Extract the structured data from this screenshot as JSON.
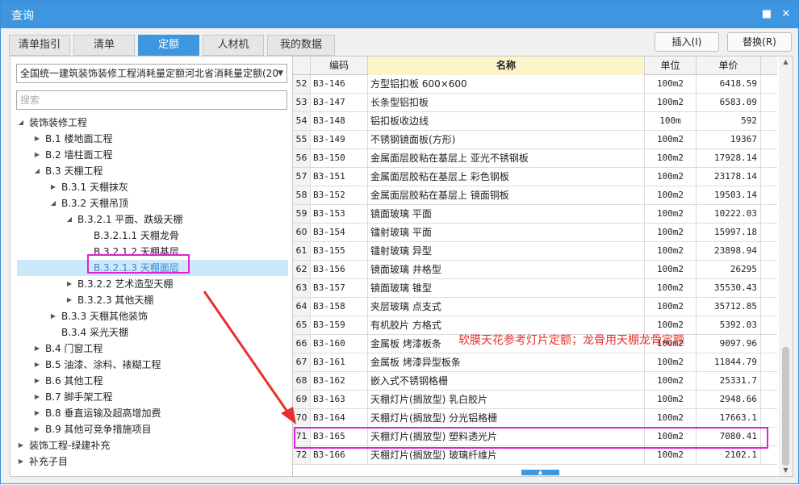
{
  "window": {
    "title": "查询",
    "menu_glyph": "■",
    "close_glyph": "✕"
  },
  "tabs": [
    {
      "label": "清单指引",
      "active": false
    },
    {
      "label": "清单",
      "active": false
    },
    {
      "label": "定额",
      "active": true
    },
    {
      "label": "人材机",
      "active": false
    },
    {
      "label": "我的数据",
      "active": false
    }
  ],
  "buttons": {
    "insert": "插入(I)",
    "replace": "替换(R)"
  },
  "library_select": {
    "value": "全国统一建筑装饰装修工程消耗量定额河北省消耗量定额(20"
  },
  "search": {
    "placeholder": "搜索",
    "value": ""
  },
  "tree": [
    {
      "label": "装饰装修工程",
      "expanded": true,
      "has_children": true
    },
    {
      "label": "B.1 楼地面工程",
      "expanded": false,
      "has_children": true
    },
    {
      "label": "B.2 墙柱面工程",
      "expanded": false,
      "has_children": true
    },
    {
      "label": "B.3 天棚工程",
      "expanded": true,
      "has_children": true
    },
    {
      "label": "B.3.1 天棚抹灰",
      "expanded": false,
      "has_children": true
    },
    {
      "label": "B.3.2 天棚吊顶",
      "expanded": true,
      "has_children": true
    },
    {
      "label": "B.3.2.1 平面、跌级天棚",
      "expanded": true,
      "has_children": true
    },
    {
      "label": "B.3.2.1.1 天棚龙骨",
      "expanded": false,
      "has_children": false
    },
    {
      "label": "B.3.2.1.2 天棚基层",
      "expanded": false,
      "has_children": false
    },
    {
      "label": "B.3.2.1.3 天棚面层",
      "expanded": false,
      "has_children": false,
      "selected": true
    },
    {
      "label": "B.3.2.2 艺术造型天棚",
      "expanded": false,
      "has_children": true
    },
    {
      "label": "B.3.2.3 其他天棚",
      "expanded": false,
      "has_children": true
    },
    {
      "label": "B.3.3 天棚其他装饰",
      "expanded": false,
      "has_children": true
    },
    {
      "label": "B.3.4 采光天棚",
      "expanded": false,
      "has_children": false
    },
    {
      "label": "B.4 门窗工程",
      "expanded": false,
      "has_children": true
    },
    {
      "label": "B.5 油漆、涂料、裱糊工程",
      "expanded": false,
      "has_children": true
    },
    {
      "label": "B.6 其他工程",
      "expanded": false,
      "has_children": true
    },
    {
      "label": "B.7 脚手架工程",
      "expanded": false,
      "has_children": true
    },
    {
      "label": "B.8 垂直运输及超高增加费",
      "expanded": false,
      "has_children": true
    },
    {
      "label": "B.9 其他可竞争措施项目",
      "expanded": false,
      "has_children": true
    },
    {
      "label": "装饰工程-绿建补充",
      "expanded": false,
      "has_children": true
    },
    {
      "label": "补充子目",
      "expanded": false,
      "has_children": true
    }
  ],
  "table": {
    "headers": {
      "code": "编码",
      "name": "名称",
      "unit": "单位",
      "price": "单价"
    },
    "rows": [
      {
        "no": "52",
        "code": "B3-146",
        "name": "方型铝扣板 600×600",
        "unit": "100m2",
        "price": "6418.59"
      },
      {
        "no": "53",
        "code": "B3-147",
        "name": "长条型铝扣板",
        "unit": "100m2",
        "price": "6583.09"
      },
      {
        "no": "54",
        "code": "B3-148",
        "name": "铝扣板收边线",
        "unit": "100m",
        "price": "592"
      },
      {
        "no": "55",
        "code": "B3-149",
        "name": "不锈钢镜面板(方形)",
        "unit": "100m2",
        "price": "19367"
      },
      {
        "no": "56",
        "code": "B3-150",
        "name": "金属面层胶粘在基层上 亚光不锈钢板",
        "unit": "100m2",
        "price": "17928.14"
      },
      {
        "no": "57",
        "code": "B3-151",
        "name": "金属面层胶粘在基层上 彩色钢板",
        "unit": "100m2",
        "price": "23178.14"
      },
      {
        "no": "58",
        "code": "B3-152",
        "name": "金属面层胶粘在基层上 镜面铜板",
        "unit": "100m2",
        "price": "19503.14"
      },
      {
        "no": "59",
        "code": "B3-153",
        "name": "镜面玻璃 平面",
        "unit": "100m2",
        "price": "10222.03"
      },
      {
        "no": "60",
        "code": "B3-154",
        "name": "镭射玻璃 平面",
        "unit": "100m2",
        "price": "15997.18"
      },
      {
        "no": "61",
        "code": "B3-155",
        "name": "镭射玻璃 异型",
        "unit": "100m2",
        "price": "23898.94"
      },
      {
        "no": "62",
        "code": "B3-156",
        "name": "镜面玻璃 井格型",
        "unit": "100m2",
        "price": "26295"
      },
      {
        "no": "63",
        "code": "B3-157",
        "name": "镜面玻璃 锥型",
        "unit": "100m2",
        "price": "35530.43"
      },
      {
        "no": "64",
        "code": "B3-158",
        "name": "夹层玻璃 点支式",
        "unit": "100m2",
        "price": "35712.85"
      },
      {
        "no": "65",
        "code": "B3-159",
        "name": "有机胶片 方格式",
        "unit": "100m2",
        "price": "5392.03"
      },
      {
        "no": "66",
        "code": "B3-160",
        "name": "金属板 烤漆板条",
        "unit": "100m2",
        "price": "9097.96"
      },
      {
        "no": "67",
        "code": "B3-161",
        "name": "金属板 烤漆异型板条",
        "unit": "100m2",
        "price": "11844.79"
      },
      {
        "no": "68",
        "code": "B3-162",
        "name": "嵌入式不锈钢格栅",
        "unit": "100m2",
        "price": "25331.7"
      },
      {
        "no": "69",
        "code": "B3-163",
        "name": "天棚灯片(搁放型) 乳白胶片",
        "unit": "100m2",
        "price": "2948.66"
      },
      {
        "no": "70",
        "code": "B3-164",
        "name": "天棚灯片(搁放型) 分光铝格栅",
        "unit": "100m2",
        "price": "17663.1"
      },
      {
        "no": "71",
        "code": "B3-165",
        "name": "天棚灯片(搁放型) 塑料透光片",
        "unit": "100m2",
        "price": "7080.41"
      },
      {
        "no": "72",
        "code": "B3-166",
        "name": "天棚灯片(搁放型) 玻璃纤维片",
        "unit": "100m2",
        "price": "2102.1"
      }
    ]
  },
  "annotation": {
    "text": "软膜天花参考灯片定额；龙骨用天棚龙骨定额",
    "color": "#e8302a",
    "highlight_color": "#e020d8"
  },
  "colors": {
    "accent": "#3f96e0",
    "selection": "#cde8fb",
    "name_header": "#fcf3c8"
  }
}
